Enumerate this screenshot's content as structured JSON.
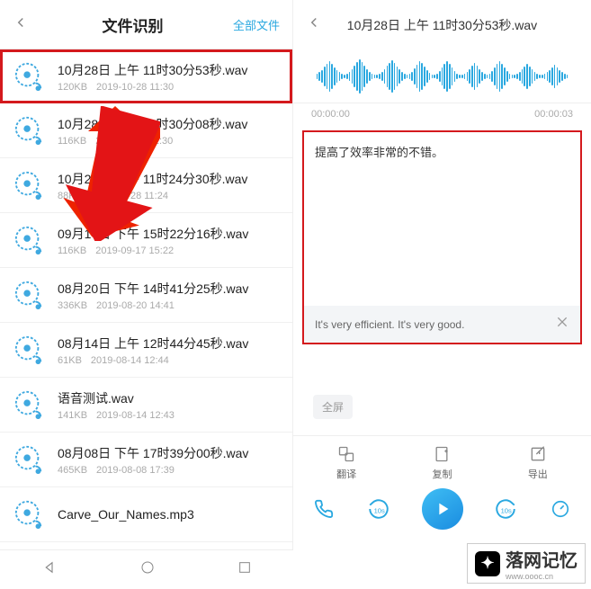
{
  "left": {
    "title": "文件识别",
    "all_label": "全部文件",
    "items": [
      {
        "name": "10月28日 上午 11时30分53秒.wav",
        "size": "120KB",
        "time": "2019-10-28 11:30",
        "selected": true
      },
      {
        "name": "10月28日 上午 11时30分08秒.wav",
        "size": "116KB",
        "time": "2019-10-28 11:30"
      },
      {
        "name": "10月28日 上午 11时24分30秒.wav",
        "size": "88KB",
        "time": "2019-10-28 11:24"
      },
      {
        "name": "09月17日 下午 15时22分16秒.wav",
        "size": "116KB",
        "time": "2019-09-17 15:22"
      },
      {
        "name": "08月20日 下午 14时41分25秒.wav",
        "size": "336KB",
        "time": "2019-08-20 14:41"
      },
      {
        "name": "08月14日 上午 12时44分45秒.wav",
        "size": "61KB",
        "time": "2019-08-14 12:44"
      },
      {
        "name": "语音测试.wav",
        "size": "141KB",
        "time": "2019-08-14 12:43"
      },
      {
        "name": "08月08日 下午 17时39分00秒.wav",
        "size": "465KB",
        "time": "2019-08-08 17:39"
      },
      {
        "name": "Carve_Our_Names.mp3",
        "size": "",
        "time": ""
      }
    ]
  },
  "right": {
    "title": "10月28日 上午 11时30分53秒.wav",
    "time_start": "00:00:00",
    "time_end": "00:00:03",
    "original_text": "提高了效率非常的不错。",
    "translated_text": "It's very efficient. It's very good.",
    "full_label": "全屏",
    "actions": {
      "translate": "翻译",
      "copy": "复制",
      "export": "导出"
    }
  },
  "watermark": {
    "main": "落网记忆",
    "sub": "www.oooc.cn"
  }
}
